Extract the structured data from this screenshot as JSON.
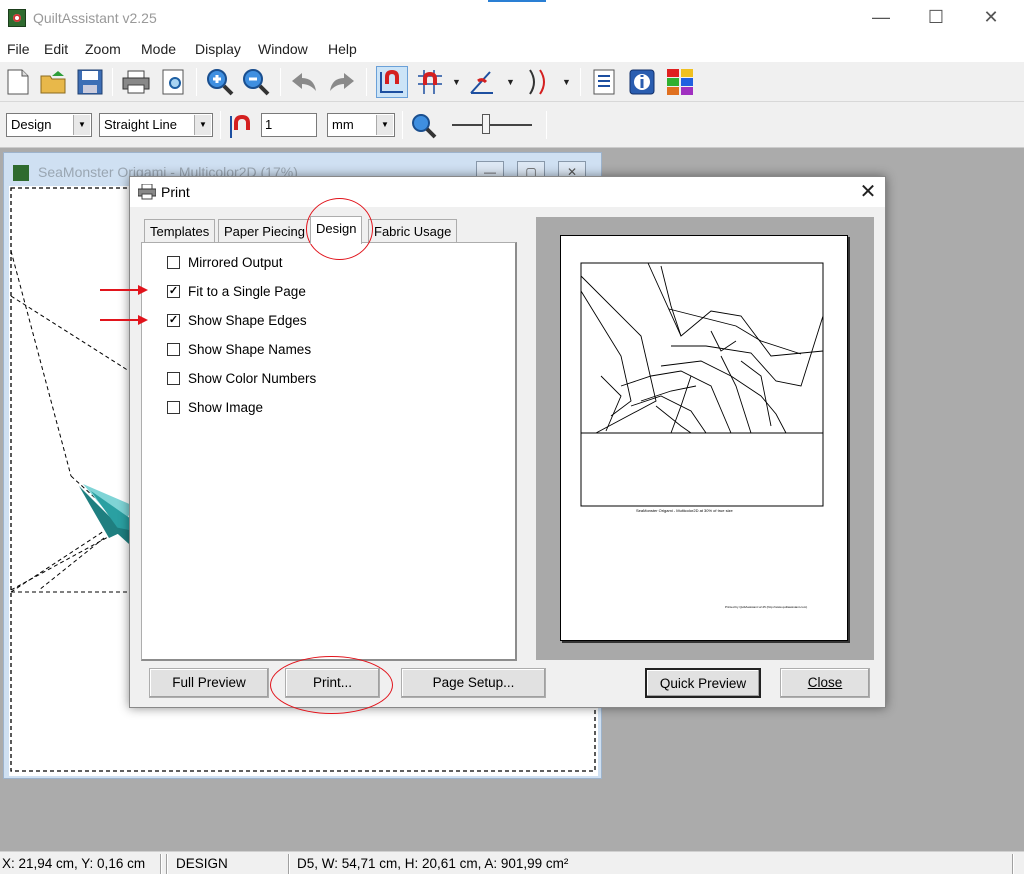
{
  "app": {
    "title": "QuiltAssistant v2.25",
    "window_controls": {
      "minimize": "—",
      "maximize": "☐",
      "close": "✕"
    }
  },
  "menu": [
    "File",
    "Edit",
    "Zoom",
    "Mode",
    "Display",
    "Window",
    "Help"
  ],
  "toolbar": {
    "icons": [
      "new-file-icon",
      "open-folder-icon",
      "save-disk-icon",
      "print-icon",
      "print-preview-icon",
      "zoom-in-icon",
      "zoom-out-icon",
      "undo-icon",
      "redo-icon",
      "snap-magnet-icon",
      "grid-magnet-icon",
      "angle-snap-icon",
      "curve-tool-icon",
      "notes-icon",
      "info-icon",
      "color-palette-icon"
    ]
  },
  "toolbar2": {
    "mode_select": "Design",
    "line_select": "Straight Line",
    "snap_value": "1",
    "unit_select": "mm",
    "zoom_level": 0.4
  },
  "child_window": {
    "title": "SeaMonster Origami - Multicolor2D (17%)",
    "controls": [
      "—",
      "▢",
      "✕"
    ]
  },
  "dialog": {
    "title": "Print",
    "close": "✕",
    "tabs": [
      {
        "label": "Templates",
        "active": false
      },
      {
        "label": "Paper Piecing",
        "active": false
      },
      {
        "label": "Design",
        "active": true
      },
      {
        "label": "Fabric Usage",
        "active": false
      }
    ],
    "options": [
      {
        "label": "Mirrored Output",
        "checked": false
      },
      {
        "label": "Fit to a Single Page",
        "checked": true
      },
      {
        "label": "Show Shape Edges",
        "checked": true
      },
      {
        "label": "Show Shape Names",
        "checked": false
      },
      {
        "label": "Show Color Numbers",
        "checked": false
      },
      {
        "label": "Show Image",
        "checked": false
      }
    ],
    "buttons": {
      "full_preview": "Full Preview",
      "print": "Print...",
      "page_setup": "Page Setup...",
      "quick_preview": "Quick Preview",
      "close": "Close"
    },
    "preview": {
      "caption": "SeaMonster Origami - Multicolor2D at 30% of true size",
      "footer": "Printed by QuiltAssistant v2.25 (http://www.quiltassistant.com)"
    }
  },
  "statusbar": {
    "coords": "X: 21,94 cm, Y: 0,16 cm",
    "mode": "DESIGN",
    "shape_info": "D5, W: 54,71 cm, H: 20,61 cm, A: 901,99 cm²"
  },
  "colors": {
    "accent_red": "#e1141c",
    "teal_dark": "#1f7f80",
    "teal_light": "#7fd4d6",
    "workspace": "#ababab"
  }
}
